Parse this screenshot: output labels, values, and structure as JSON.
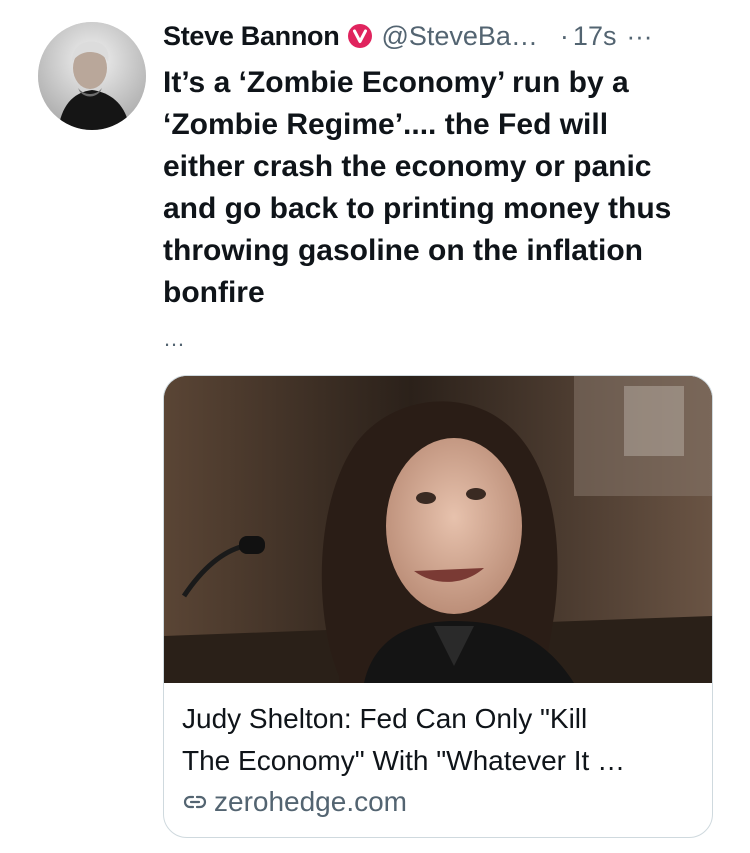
{
  "tweet": {
    "author_name": "Steve Bannon",
    "handle": "@SteveBa…",
    "separator": "·",
    "time": "17s",
    "more_label": "···",
    "text": "It’s a ‘Zombie Economy’ run by a\n‘Zombie Regime’.... the Fed will\neither crash the economy or panic\nand go back to printing money thus\nthrowing gasoline on the inflation\nbonfire",
    "truncation": "…",
    "card": {
      "title": "Judy Shelton: Fed Can Only \"Kill\nThe Economy\" With \"Whatever It …",
      "domain": "zerohedge.com"
    }
  },
  "colors": {
    "verified_badge": "#e0245e",
    "secondary_text": "#536471",
    "card_border": "#cfd9de"
  },
  "icons": {
    "verified": "verified-badge-icon",
    "link": "link-icon"
  }
}
